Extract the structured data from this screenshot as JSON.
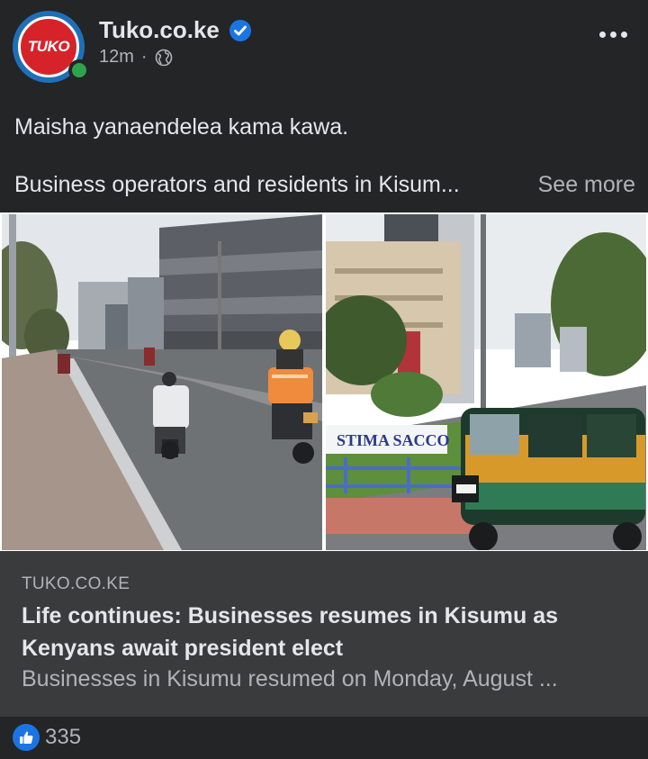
{
  "post": {
    "page_name": "Tuko.co.ke",
    "avatar_text": "TUKO",
    "time_ago": "12m",
    "separator": "·",
    "audience_icon": "globe-icon",
    "verified_icon": "verified-badge-icon",
    "line1": "Maisha yanaendelea kama kawa.",
    "line2": "Business operators and residents in Kisum...",
    "see_more": "See more"
  },
  "link_preview": {
    "domain": "TUKO.CO.KE",
    "title": "Life continues: Businesses resumes in Kisumu as Kenyans await president elect",
    "description": "Businesses in Kisumu resumed on Monday, August ..."
  },
  "photos": {
    "right_sign_text": "STIMA SACCO"
  },
  "reactions": {
    "icon": "thumbs-up-icon",
    "count": "335"
  },
  "colors": {
    "background": "#242526",
    "link_card": "#3a3b3c",
    "like_blue": "#1b74e4",
    "online_green": "#31a24c",
    "brand_red": "#d6232a"
  }
}
